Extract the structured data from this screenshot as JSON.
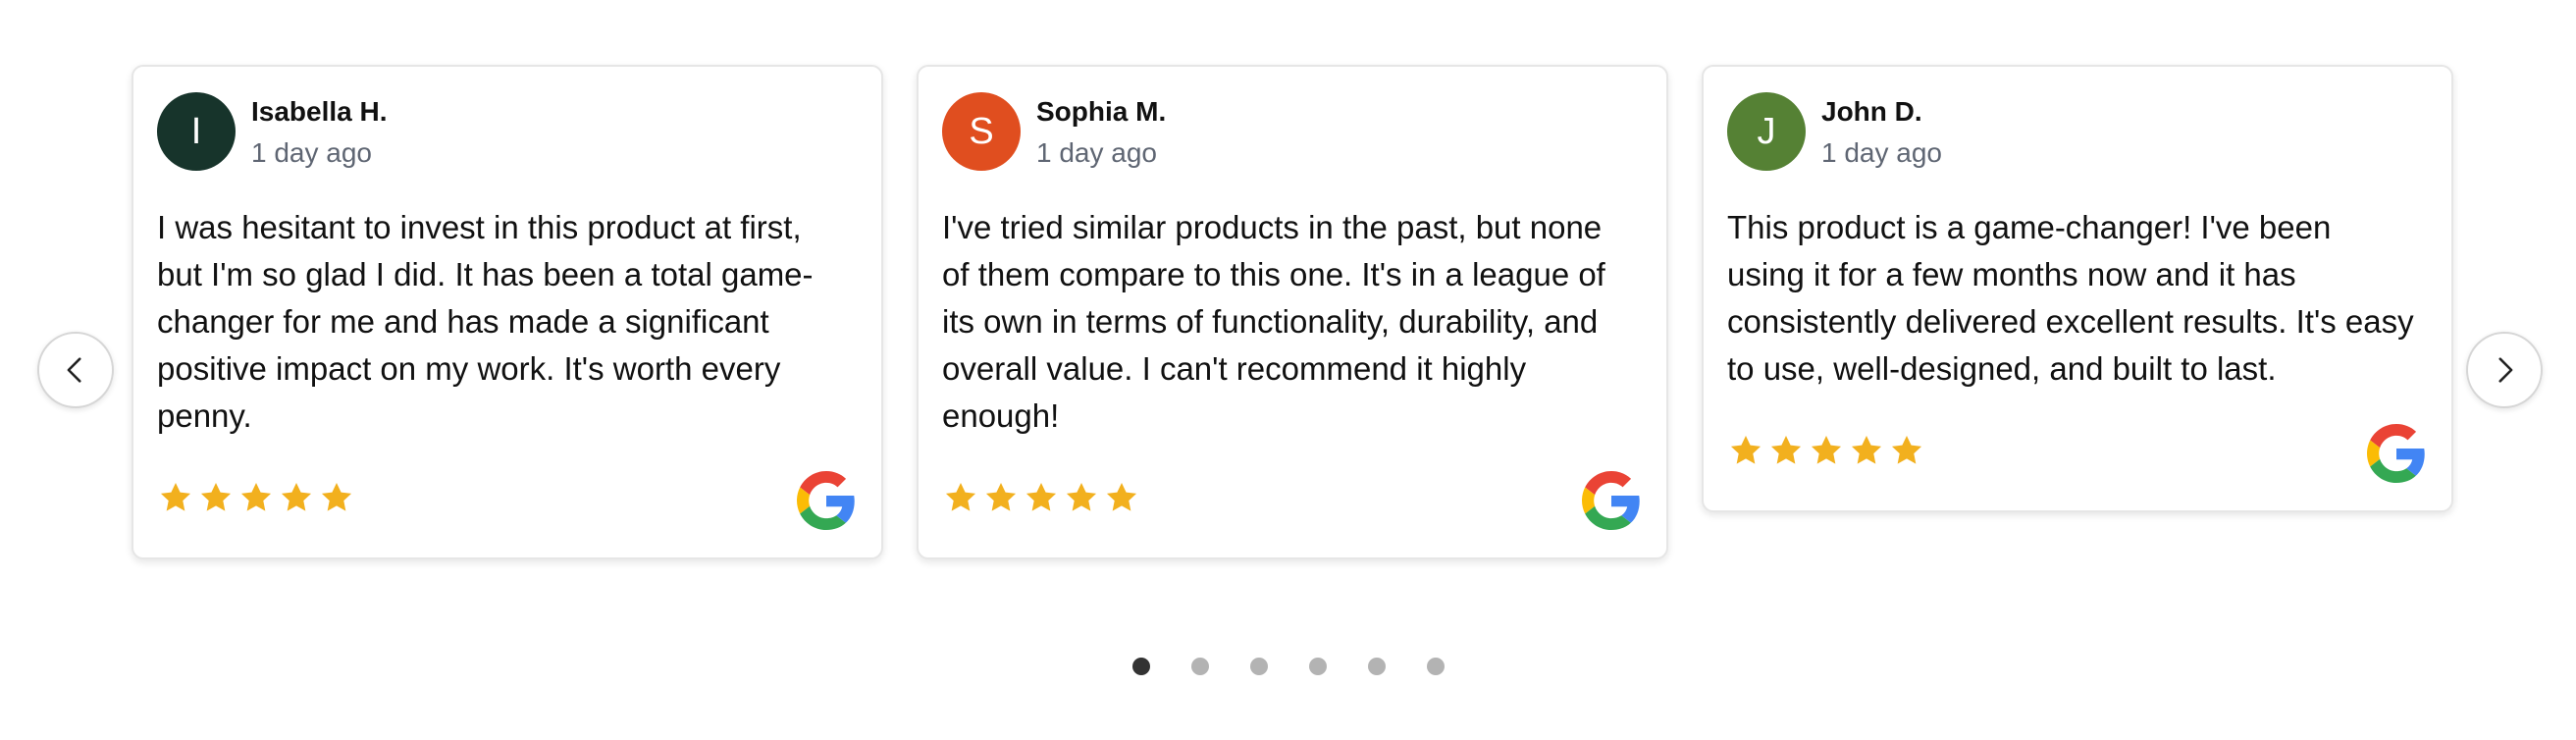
{
  "colors": {
    "star": "#F2B01E",
    "dot_active": "#333333",
    "dot_inactive": "#B3B3B3"
  },
  "navigation": {
    "prev_icon": "chevron-left-icon",
    "next_icon": "chevron-right-icon"
  },
  "reviews": [
    {
      "initial": "I",
      "avatar_color": "#17342B",
      "name": "Isabella H.",
      "time": "1 day ago",
      "text": "I was hesitant to invest in this product at first, but I'm so glad I did. It has been a total game-changer for me and has made a significant positive impact on my work. It's worth every penny.",
      "rating": 5,
      "source_icon": "google-icon"
    },
    {
      "initial": "S",
      "avatar_color": "#E04E1F",
      "name": "Sophia M.",
      "time": "1 day ago",
      "text": "I've tried similar products in the past, but none of them compare to this one. It's in a league of its own in terms of functionality, durability, and overall value. I can't recommend it highly enough!",
      "rating": 5,
      "source_icon": "google-icon"
    },
    {
      "initial": "J",
      "avatar_color": "#558134",
      "name": "John D.",
      "time": "1 day ago",
      "text": "This product is a game-changer! I've been using it for a few months now and it has consistently delivered excellent results. It's easy to use, well-designed, and built to last.",
      "rating": 5,
      "source_icon": "google-icon"
    }
  ],
  "pagination": {
    "total": 6,
    "active_index": 0
  }
}
